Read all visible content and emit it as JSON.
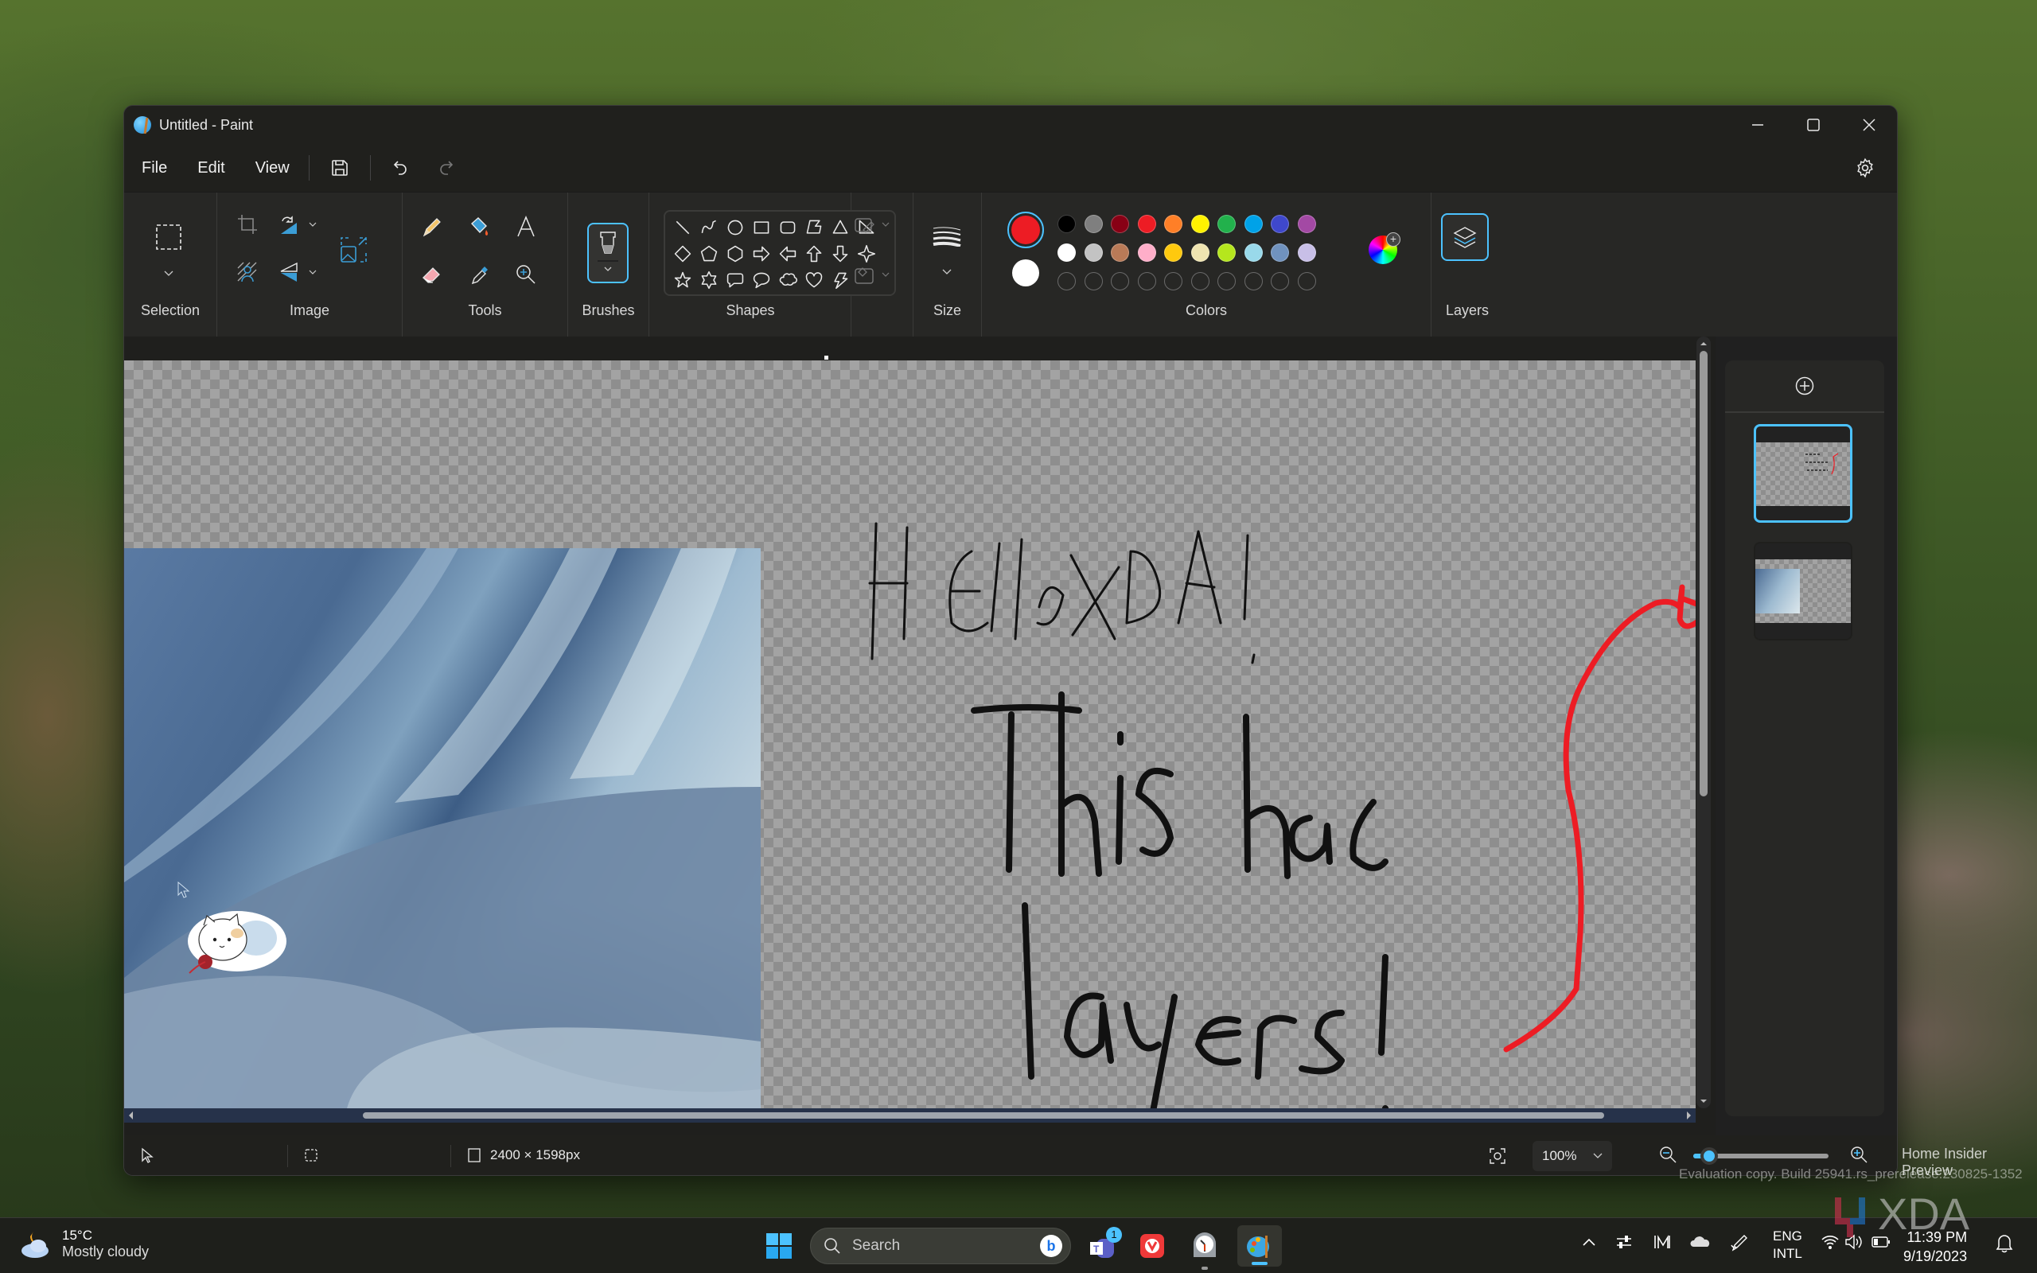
{
  "window": {
    "title": "Untitled - Paint",
    "controls": {
      "minimize": "minimize-icon",
      "maximize": "maximize-icon",
      "close": "close-icon"
    }
  },
  "menubar": {
    "items": [
      "File",
      "Edit",
      "View"
    ],
    "quick_actions": [
      "save-icon",
      "undo-icon",
      "redo-icon"
    ],
    "settings_icon": "gear-icon"
  },
  "ribbon": {
    "groups": {
      "selection": "Selection",
      "image": "Image",
      "tools": "Tools",
      "brushes": "Brushes",
      "shapes": "Shapes",
      "size": "Size",
      "colors": "Colors",
      "layers": "Layers"
    },
    "image_tools": [
      "crop-icon",
      "rotate-icon",
      "resize-icon",
      "remove-background-icon",
      "flip-icon"
    ],
    "tools": [
      "pencil-icon",
      "fill-icon",
      "text-icon",
      "eraser-icon",
      "color-picker-icon",
      "magnifier-icon"
    ],
    "shapes": [
      "line",
      "curve",
      "oval",
      "rectangle",
      "rounded-rectangle",
      "polygon",
      "triangle",
      "right-triangle",
      "diamond",
      "pentagon",
      "hexagon",
      "arrow-right",
      "arrow-left",
      "arrow-up",
      "arrow-down",
      "four-point-star",
      "five-point-star",
      "six-point-star",
      "rounded-callout",
      "oval-callout",
      "cloud-callout",
      "heart",
      "lightning"
    ],
    "primary_color": "#ed1c24",
    "secondary_color": "#ffffff",
    "palette_row1": [
      "#000000",
      "#7f7f7f",
      "#880015",
      "#ed1c24",
      "#ff7f27",
      "#fff200",
      "#22b14c",
      "#00a2e8",
      "#3f48cc",
      "#a349a4"
    ],
    "palette_row2": [
      "#ffffff",
      "#c3c3c3",
      "#b97a57",
      "#ffaec9",
      "#ffc90e",
      "#efe4b0",
      "#b5e61d",
      "#99d9ea",
      "#7092be",
      "#c8bfe7"
    ],
    "custom_slots": 10,
    "accent": "#4cc2ff"
  },
  "canvas": {
    "handwriting_line1": "Hello XDA!",
    "handwriting_line2": "This has",
    "handwriting_line3": "layers!"
  },
  "layers_panel": {
    "add_layer_icon": "add-layer-icon",
    "layers": [
      {
        "name": "layer-drawing",
        "selected": true
      },
      {
        "name": "layer-photo",
        "selected": false
      }
    ]
  },
  "statusbar": {
    "canvas_size": "2400 × 1598px",
    "zoom": "100%",
    "zoom_fraction": 0.12
  },
  "taskbar": {
    "weather_temp": "15°C",
    "weather_desc": "Mostly cloudy",
    "search_placeholder": "Search",
    "teams_badge": "1",
    "lang_line1": "ENG",
    "lang_line2": "INTL",
    "time": "11:39 PM",
    "date": "9/19/2023"
  },
  "watermark": {
    "line1": "Home Insider Preview",
    "line2": "Evaluation copy. Build 25941.rs_prerelease.230825-1352"
  }
}
